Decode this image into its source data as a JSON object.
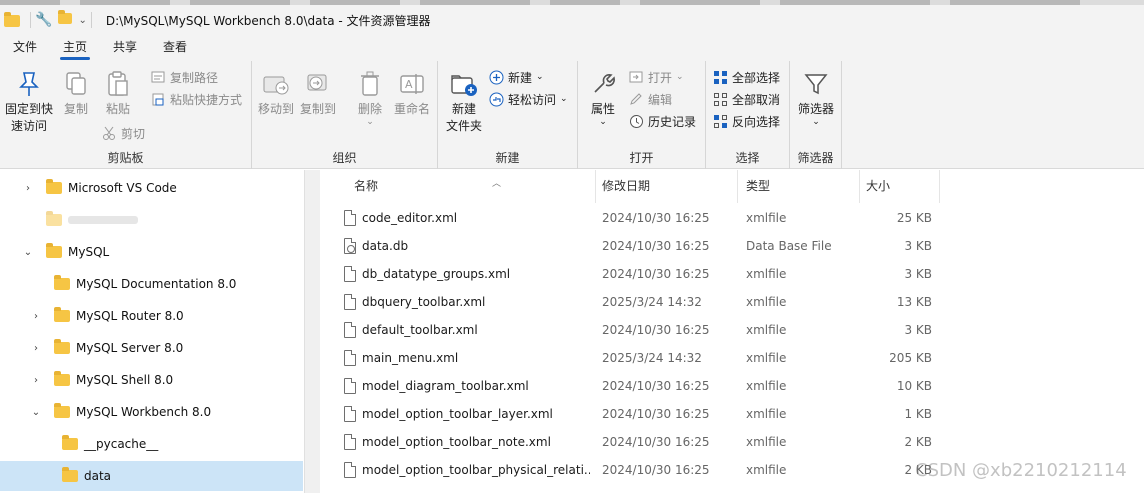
{
  "window": {
    "title": "D:\\MySQL\\MySQL Workbench 8.0\\data - 文件资源管理器"
  },
  "menu_tabs": [
    {
      "label": "文件",
      "active": false
    },
    {
      "label": "主页",
      "active": true
    },
    {
      "label": "共享",
      "active": false
    },
    {
      "label": "查看",
      "active": false
    }
  ],
  "ribbon": {
    "clipboard": {
      "label": "剪贴板",
      "pin": "固定到快\n速访问",
      "copy": "复制",
      "paste": "粘贴",
      "copy_path": "复制路径",
      "paste_shortcut": "粘贴快捷方式",
      "cut": "剪切"
    },
    "organize": {
      "label": "组织",
      "move_to": "移动到",
      "copy_to": "复制到",
      "delete": "删除",
      "rename": "重命名"
    },
    "new": {
      "label": "新建",
      "new_folder": "新建\n文件夹",
      "new_item": "新建",
      "easy_access": "轻松访问"
    },
    "open": {
      "label": "打开",
      "properties": "属性",
      "open": "打开",
      "edit": "编辑",
      "history": "历史记录"
    },
    "select": {
      "label": "选择",
      "select_all": "全部选择",
      "select_none": "全部取消",
      "invert": "反向选择"
    },
    "filter": {
      "label": "筛选器",
      "filter": "筛选器"
    }
  },
  "nav": {
    "items": [
      {
        "label": "Microsoft VS Code",
        "chevron": "›",
        "indent": 0
      },
      {
        "label": "",
        "chevron": "",
        "indent": 0
      },
      {
        "label": "MySQL",
        "chevron": "⌄",
        "indent": 0
      },
      {
        "label": "MySQL Documentation 8.0",
        "chevron": "",
        "indent": 1
      },
      {
        "label": "MySQL Router 8.0",
        "chevron": "›",
        "indent": 1
      },
      {
        "label": "MySQL Server 8.0",
        "chevron": "›",
        "indent": 1
      },
      {
        "label": "MySQL Shell 8.0",
        "chevron": "›",
        "indent": 1
      },
      {
        "label": "MySQL Workbench 8.0",
        "chevron": "⌄",
        "indent": 1
      },
      {
        "label": "__pycache__",
        "chevron": "",
        "indent": 2
      },
      {
        "label": "data",
        "chevron": "",
        "indent": 2,
        "selected": true
      }
    ]
  },
  "columns": {
    "name": "名称",
    "modified": "修改日期",
    "type": "类型",
    "size": "大小"
  },
  "files": [
    {
      "name": "code_editor.xml",
      "modified": "2024/10/30 16:25",
      "type": "xmlfile",
      "size": "25 KB",
      "icon": "file-icon"
    },
    {
      "name": "data.db",
      "modified": "2024/10/30 16:25",
      "type": "Data Base File",
      "size": "3 KB",
      "icon": "db-file-icon"
    },
    {
      "name": "db_datatype_groups.xml",
      "modified": "2024/10/30 16:25",
      "type": "xmlfile",
      "size": "3 KB",
      "icon": "file-icon"
    },
    {
      "name": "dbquery_toolbar.xml",
      "modified": "2025/3/24 14:32",
      "type": "xmlfile",
      "size": "13 KB",
      "icon": "file-icon"
    },
    {
      "name": "default_toolbar.xml",
      "modified": "2024/10/30 16:25",
      "type": "xmlfile",
      "size": "3 KB",
      "icon": "file-icon"
    },
    {
      "name": "main_menu.xml",
      "modified": "2025/3/24 14:32",
      "type": "xmlfile",
      "size": "205 KB",
      "icon": "file-icon"
    },
    {
      "name": "model_diagram_toolbar.xml",
      "modified": "2024/10/30 16:25",
      "type": "xmlfile",
      "size": "10 KB",
      "icon": "file-icon"
    },
    {
      "name": "model_option_toolbar_layer.xml",
      "modified": "2024/10/30 16:25",
      "type": "xmlfile",
      "size": "1 KB",
      "icon": "file-icon"
    },
    {
      "name": "model_option_toolbar_note.xml",
      "modified": "2024/10/30 16:25",
      "type": "xmlfile",
      "size": "2 KB",
      "icon": "file-icon"
    },
    {
      "name": "model_option_toolbar_physical_relati...",
      "modified": "2024/10/30 16:25",
      "type": "xmlfile",
      "size": "2 KB",
      "icon": "file-icon"
    }
  ],
  "watermark": "CSDN @xb2210212114",
  "colors": {
    "accent": "#1a62c0",
    "selection": "#cce4f7",
    "folder": "#f6c544",
    "ribbon_bg": "#f3f3f3"
  }
}
